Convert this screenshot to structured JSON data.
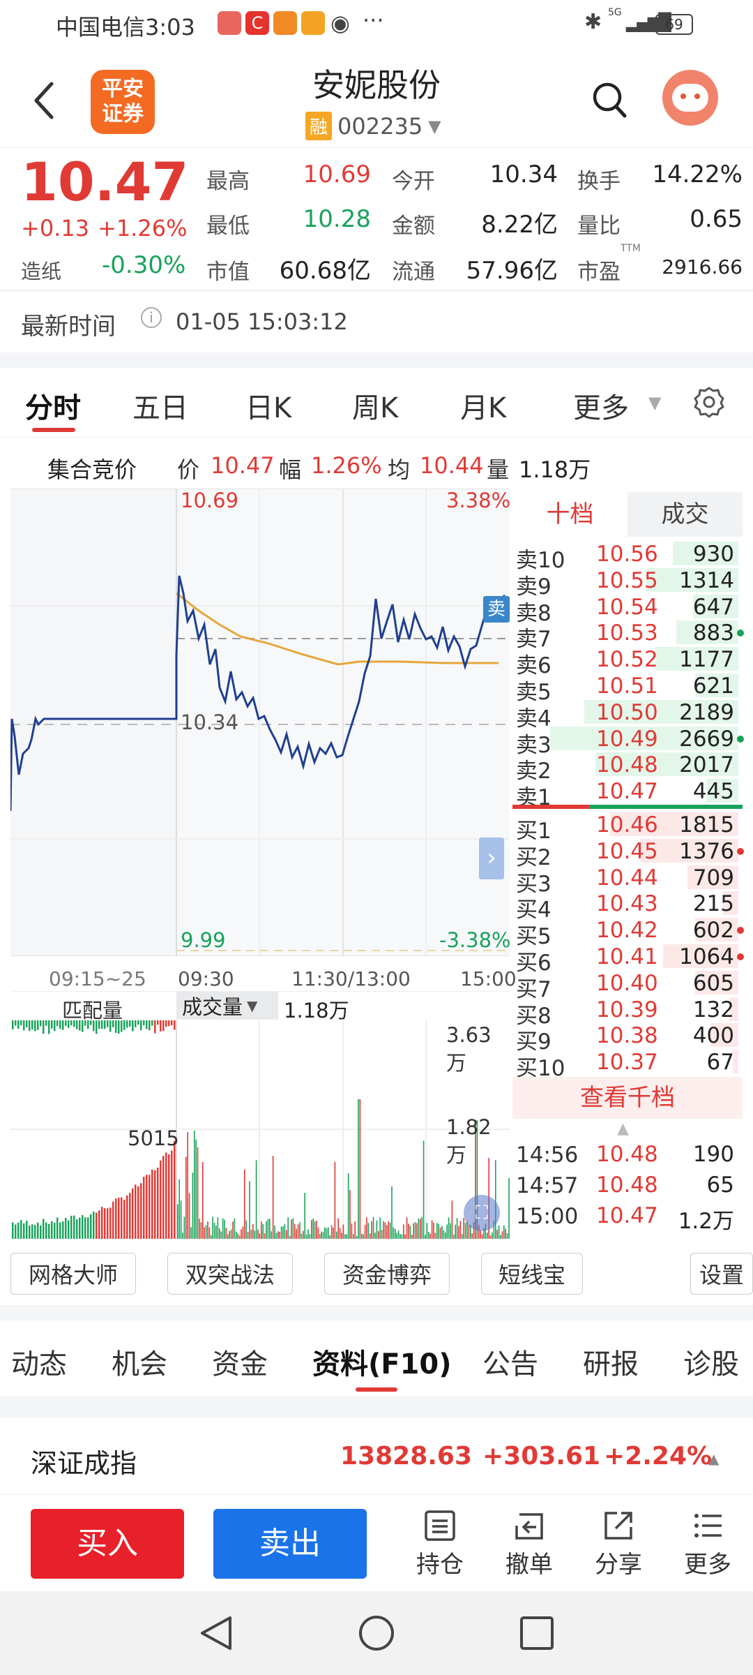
{
  "status": {
    "carrier_time": "中国电信3:03",
    "signal": "5G",
    "battery": "69"
  },
  "header": {
    "broker_logo": "平安证券",
    "stock_name": "安妮股份",
    "margin_tag": "融",
    "stock_code": "002235"
  },
  "quote": {
    "price": "10.47",
    "change": "+0.13",
    "change_pct": "+1.26%",
    "sector_label": "造纸",
    "sector_pct": "-0.30%",
    "high_label": "最高",
    "high": "10.69",
    "low_label": "最低",
    "low": "10.28",
    "mktcap_label": "市值",
    "mktcap": "60.68亿",
    "open_label": "今开",
    "open": "10.34",
    "amount_label": "金额",
    "amount": "8.22亿",
    "float_label": "流通",
    "float": "57.96亿",
    "turnover_label": "换手",
    "turnover": "14.22%",
    "volratio_label": "量比",
    "volratio": "0.65",
    "pe_label": "市盈",
    "pe_sup": "TTM",
    "pe": "2916.66"
  },
  "time_row": {
    "label": "最新时间",
    "value": "01-05 15:03:12"
  },
  "tabs": [
    "分时",
    "五日",
    "日K",
    "周K",
    "月K",
    "更多"
  ],
  "infobar": {
    "auction": "集合竞价",
    "price_label": "价",
    "price": "10.47",
    "amp_label": "幅",
    "amp": "1.26%",
    "avg_label": "均",
    "avg": "10.44",
    "vol_label": "量",
    "vol": "1.18万"
  },
  "chart": {
    "y_top": "10.69",
    "y_mid": "10.34",
    "y_bottom": "9.99",
    "pct_top": "3.38%",
    "pct_bottom": "-3.38%",
    "x_labels": [
      "09:15~25",
      "09:30",
      "11:30/13:00",
      "15:00"
    ],
    "sell_badge": "卖"
  },
  "vol_header": {
    "match": "匹配量",
    "selector": "成交量",
    "value": "1.18万"
  },
  "vol_axis": {
    "top": "3.63万",
    "mid": "1.82万",
    "auction": "5015"
  },
  "book_tabs": {
    "depth": "十档",
    "trades": "成交"
  },
  "asks": [
    {
      "label": "卖10",
      "price": "10.56",
      "qty": "930",
      "w": 0.35
    },
    {
      "label": "卖9",
      "price": "10.55",
      "qty": "1314",
      "w": 0.49
    },
    {
      "label": "卖8",
      "price": "10.54",
      "qty": "647",
      "w": 0.24
    },
    {
      "label": "卖7",
      "price": "10.53",
      "qty": "883",
      "w": 0.33,
      "dot": "green"
    },
    {
      "label": "卖6",
      "price": "10.52",
      "qty": "1177",
      "w": 0.44
    },
    {
      "label": "卖5",
      "price": "10.51",
      "qty": "621",
      "w": 0.23
    },
    {
      "label": "卖4",
      "price": "10.50",
      "qty": "2189",
      "w": 0.82
    },
    {
      "label": "卖3",
      "price": "10.49",
      "qty": "2669",
      "w": 1.0,
      "dot": "green"
    },
    {
      "label": "卖2",
      "price": "10.48",
      "qty": "2017",
      "w": 0.76
    },
    {
      "label": "卖1",
      "price": "10.47",
      "qty": "445",
      "w": 0.17
    }
  ],
  "bids": [
    {
      "label": "买1",
      "price": "10.46",
      "qty": "1815",
      "w": 0.68
    },
    {
      "label": "买2",
      "price": "10.45",
      "qty": "1376",
      "w": 0.52,
      "dot": "red"
    },
    {
      "label": "买3",
      "price": "10.44",
      "qty": "709",
      "w": 0.27
    },
    {
      "label": "买4",
      "price": "10.43",
      "qty": "215",
      "w": 0.08
    },
    {
      "label": "买5",
      "price": "10.42",
      "qty": "602",
      "w": 0.23,
      "dot": "red"
    },
    {
      "label": "买6",
      "price": "10.41",
      "qty": "1064",
      "w": 0.4,
      "dot": "red"
    },
    {
      "label": "买7",
      "price": "10.40",
      "qty": "605",
      "w": 0.23
    },
    {
      "label": "买8",
      "price": "10.39",
      "qty": "132",
      "w": 0.05
    },
    {
      "label": "买9",
      "price": "10.38",
      "qty": "400",
      "w": 0.15
    },
    {
      "label": "买10",
      "price": "10.37",
      "qty": "67",
      "w": 0.03
    }
  ],
  "view_more": "查看千档",
  "ticks": [
    {
      "t": "14:56",
      "p": "10.48",
      "q": "190"
    },
    {
      "t": "14:57",
      "p": "10.48",
      "q": "65"
    },
    {
      "t": "15:00",
      "p": "10.47",
      "q": "1.2万"
    }
  ],
  "tools": [
    "网格大师",
    "双突战法",
    "资金博弈",
    "短线宝",
    "设置"
  ],
  "f10_tabs": [
    "动态",
    "机会",
    "资金",
    "资料(F10)",
    "公告",
    "研报",
    "诊股"
  ],
  "index": {
    "name": "深证成指",
    "value": "13828.63",
    "change": "+303.61",
    "pct": "+2.24%"
  },
  "actions": {
    "buy": "买入",
    "sell": "卖出",
    "hold": "持仓",
    "cancel": "撤单",
    "share": "分享",
    "more": "更多"
  },
  "colors": {
    "up": "#e03a35",
    "down": "#18a35a",
    "accent": "#e03a35",
    "buy": "#e8202a",
    "sell": "#1a73e8",
    "price_line": "#1f3f8f",
    "avg_line": "#e5a63a"
  }
}
